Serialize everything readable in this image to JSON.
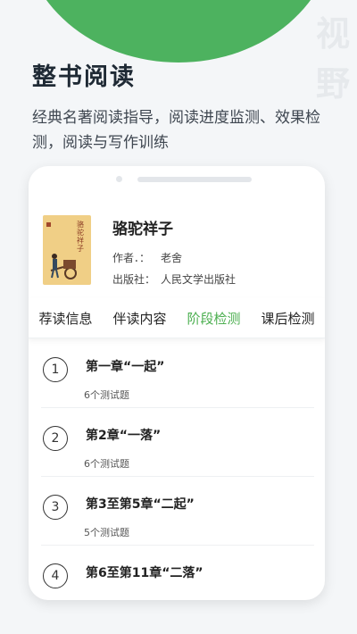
{
  "watermark": [
    "视",
    "野"
  ],
  "promo": {
    "title": "整书阅读",
    "description": "经典名著阅读指导，阅读进度监测、效果检测，阅读与写作训练"
  },
  "book": {
    "cover_title": "骆驼祥子",
    "title": "骆驼祥子",
    "author_label": "作者．：",
    "author": "老舍",
    "publisher_label": "出版社：",
    "publisher": "人民文学出版社"
  },
  "tabs": [
    {
      "label": "荐读信息",
      "active": false
    },
    {
      "label": "伴读内容",
      "active": false
    },
    {
      "label": "阶段检测",
      "active": true
    },
    {
      "label": "课后检测",
      "active": false
    }
  ],
  "chapters": [
    {
      "num": "1",
      "title": "第一章“一起”",
      "count": "6个测试题"
    },
    {
      "num": "2",
      "title": "第2章“一落”",
      "count": "6个测试题"
    },
    {
      "num": "3",
      "title": "第3至第5章“二起”",
      "count": "5个测试题"
    },
    {
      "num": "4",
      "title": "第6至第11章“二落”",
      "count": ""
    }
  ],
  "colors": {
    "accent": "#4caf50",
    "brand_arc": "#4db25f"
  }
}
